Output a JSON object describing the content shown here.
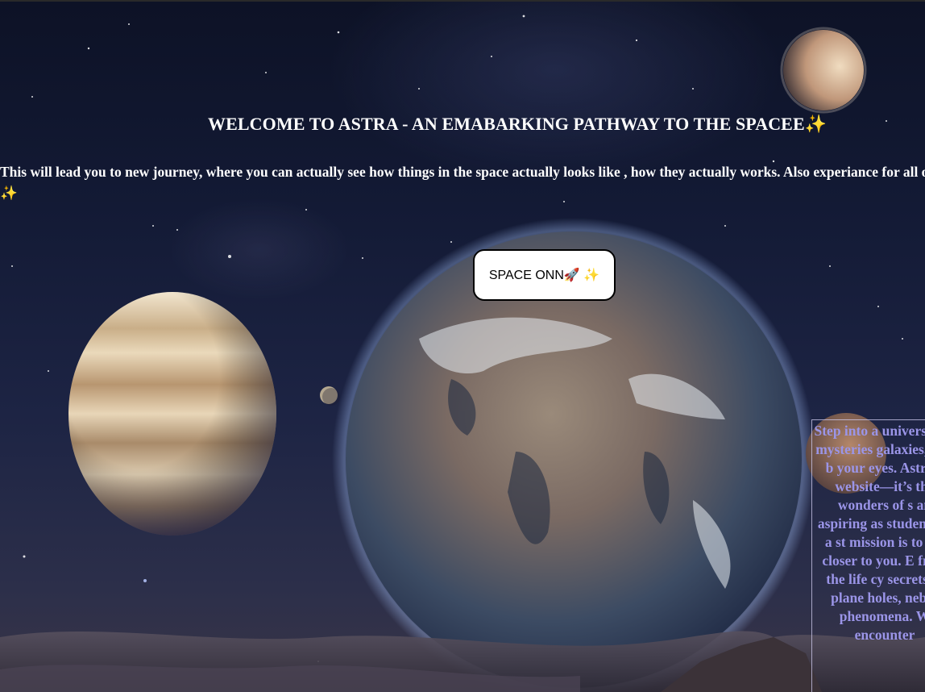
{
  "header": {
    "title": "WELCOME TO ASTRA - AN EMABARKING PATHWAY TO THE SPACEE✨"
  },
  "intro": {
    "text": "This will lead you to new journey, where you can actually see how things in the space actually looks like , how they actually works. Also experiance for all of you!!✨"
  },
  "cta": {
    "label": "SPACE ONN🚀 ✨"
  },
  "about": {
    "text": "Step into a universe the mysteries galaxies, and b your eyes. Astro a website—it’s the wonders of s an aspiring as student, or a st mission is to bri closer to you. E from the life cy secrets of plane holes, nebul phenomena. W encounter"
  },
  "colors": {
    "page_background": "#131a35",
    "button_background": "#ffffff",
    "button_border": "#000000",
    "about_text": "#9b95e8"
  }
}
